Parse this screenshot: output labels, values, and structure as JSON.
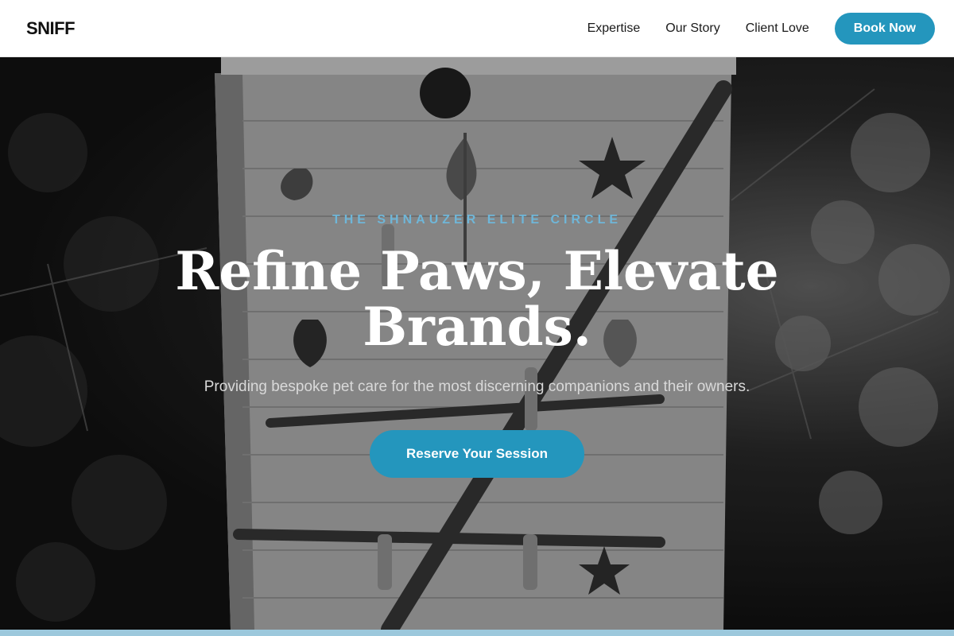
{
  "nav": {
    "logo": "SNIFF",
    "links": [
      "Expertise",
      "Our Story",
      "Client Love"
    ],
    "cta_label": "Book Now"
  },
  "hero": {
    "eyebrow": "THE SHNAUZER ELITE CIRCLE",
    "headline": "Refine Paws, Elevate Brands.",
    "subline": "Providing bespoke pet care for the most discerning companions and their owners.",
    "cta_label": "Reserve Your Session"
  },
  "colors": {
    "accent": "#2496bd",
    "eyebrow": "#6fb6d8",
    "nav_bg": "#ffffff"
  }
}
